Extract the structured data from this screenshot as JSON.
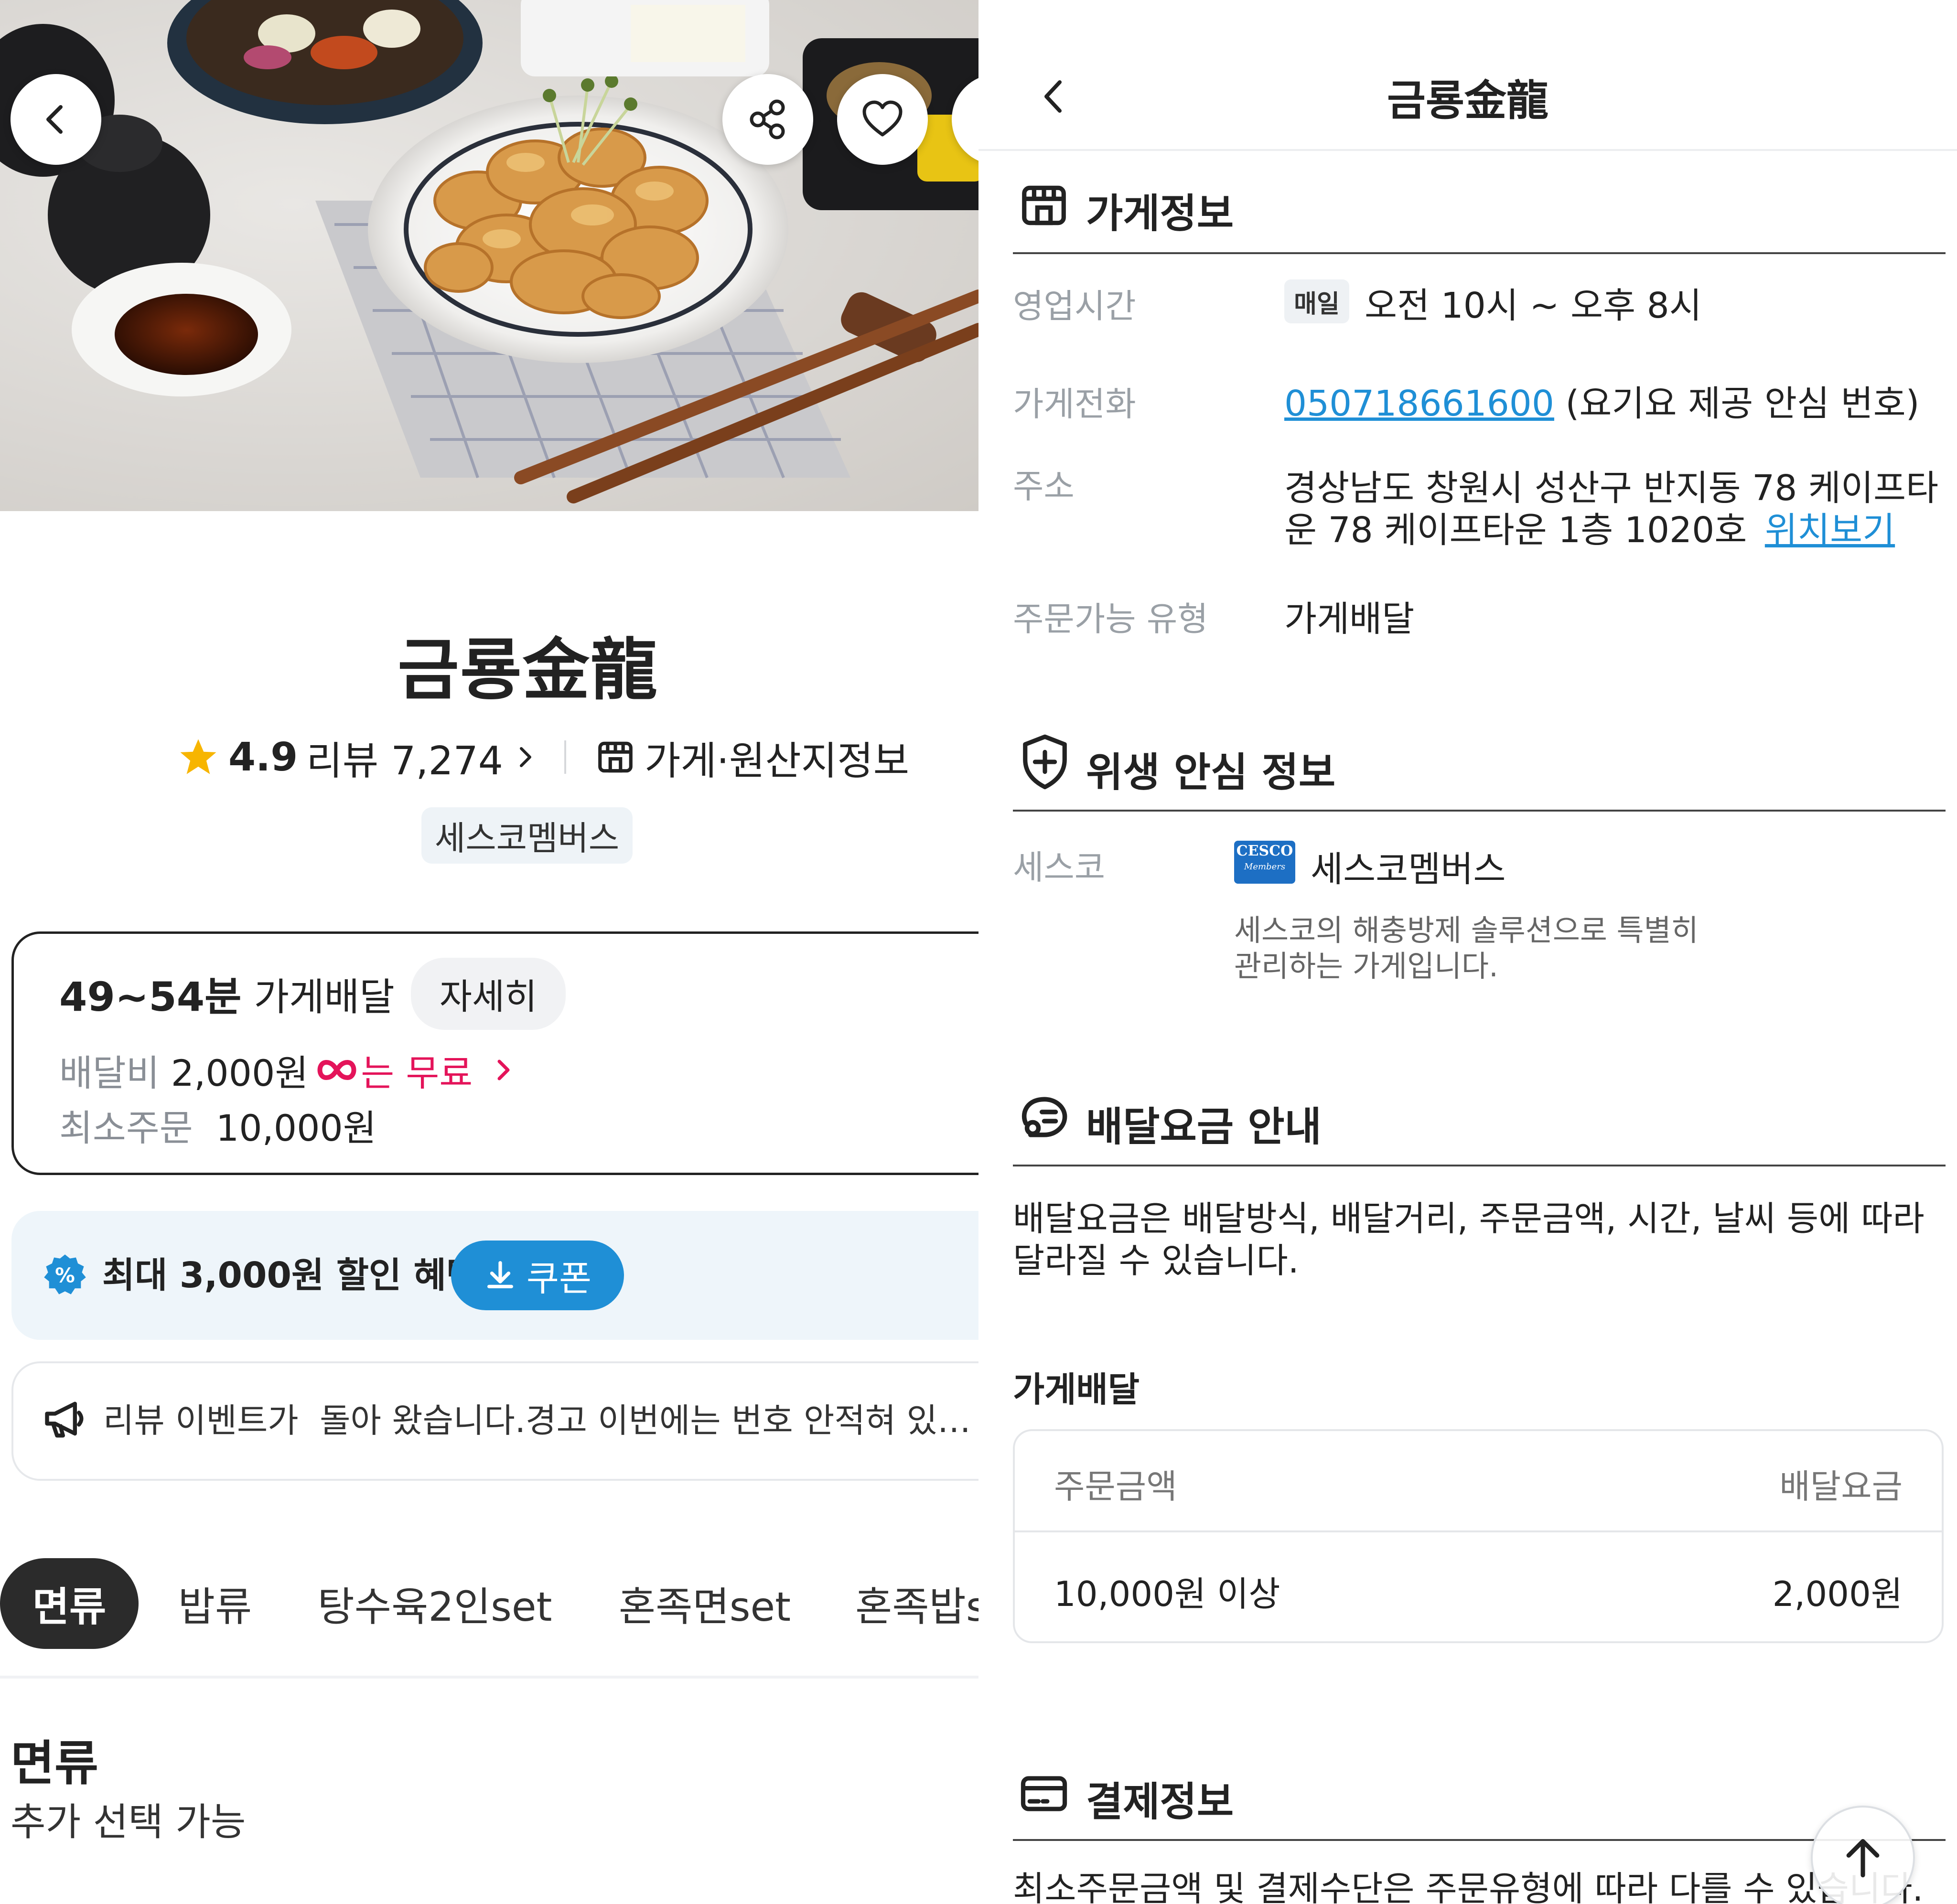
{
  "left": {
    "store_name": "금룡金龍",
    "rating": "4.9",
    "review_label": "리뷰 7,274",
    "store_info_link": "가게·원산지정보",
    "cesco_badge": "세스코멤버스",
    "delivery": {
      "time": "49~54분",
      "type": "가게배달",
      "detail_button": "자세히",
      "fee_label": "배달비",
      "fee_value": "2,000원",
      "free_text": "는 무료",
      "min_label": "최소주문",
      "min_value": "10,000원"
    },
    "coupon": {
      "text": "최대 3,000원 할인 혜택",
      "button": "쿠폰"
    },
    "notice": {
      "text": "리뷰 이벤트가  돌아 왔습니다.경고 이번에는 번호 안적혀 있…"
    },
    "tabs": [
      "면류",
      "밥류",
      "탕수육2인set",
      "혼족면set",
      "혼족밥s"
    ],
    "section": {
      "title": "면류",
      "subtitle": "추가 선택 가능"
    }
  },
  "right": {
    "header_title": "금룡金龍",
    "store_info": {
      "title": "가게정보",
      "hours_label": "영업시간",
      "hours_badge": "매일",
      "hours_value": "오전 10시 ~ 오후 8시",
      "phone_label": "가게전화",
      "phone_number": "050718661600",
      "phone_note": "(요기요 제공 안심 번호)",
      "address_label": "주소",
      "address_line1": "경상남도 창원시 성산구 반지동 78 케이프타",
      "address_line2": "운 78 케이프타운 1층 1020호",
      "map_link": "위치보기",
      "order_type_label": "주문가능 유형",
      "order_type_value": "가게배달"
    },
    "hygiene": {
      "title": "위생 안심 정보",
      "cesco_label": "세스코",
      "cesco_logo_text": "CESCO",
      "cesco_logo_sub": "Members",
      "cesco_name": "세스코멤버스",
      "cesco_desc_1": "세스코의 해충방제 솔루션으로 특별히",
      "cesco_desc_2": "관리하는 가게입니다."
    },
    "delivery_fee": {
      "title": "배달요금 안내",
      "desc_1": "배달요금은 배달방식, 배달거리, 주문금액, 시간, 날씨 등에 따라",
      "desc_2": "달라질 수 있습니다.",
      "subtitle": "가게배달",
      "col_amount": "주문금액",
      "col_fee": "배달요금",
      "row_amount": "10,000원 이상",
      "row_fee": "2,000원"
    },
    "payment": {
      "title": "결제정보",
      "desc": "최소주문금액 및 결제수단은 주문유형에 따라 다를 수 있습니다."
    }
  },
  "colors": {
    "accent_blue": "#1f8fd6",
    "pink": "#e4145a",
    "dark_chip": "#2b2b2b"
  },
  "icons": [
    "back-icon",
    "share-icon",
    "heart-icon",
    "star-icon",
    "store-icon",
    "chevron-right-icon",
    "coupon-percent-icon",
    "download-icon",
    "megaphone-icon",
    "shield-plus-icon",
    "delivery-icon",
    "card-icon",
    "arrow-up-icon"
  ]
}
